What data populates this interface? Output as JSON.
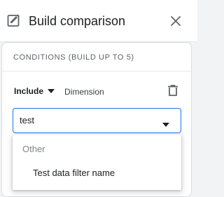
{
  "header": {
    "title": "Build comparison",
    "edit_icon": "edit-comparison-icon",
    "close_icon": "close-icon"
  },
  "conditions": {
    "section_label": "CONDITIONS (BUILD UP TO 5)",
    "include_label": "Include",
    "dimension_label": "Dimension",
    "delete_icon": "trash-icon",
    "search_value": "test"
  },
  "dropdown": {
    "section_label": "Other",
    "options": [
      "Test data filter name"
    ]
  },
  "colors": {
    "accent": "#1a73e8",
    "text": "#202124",
    "muted": "#80868b"
  }
}
